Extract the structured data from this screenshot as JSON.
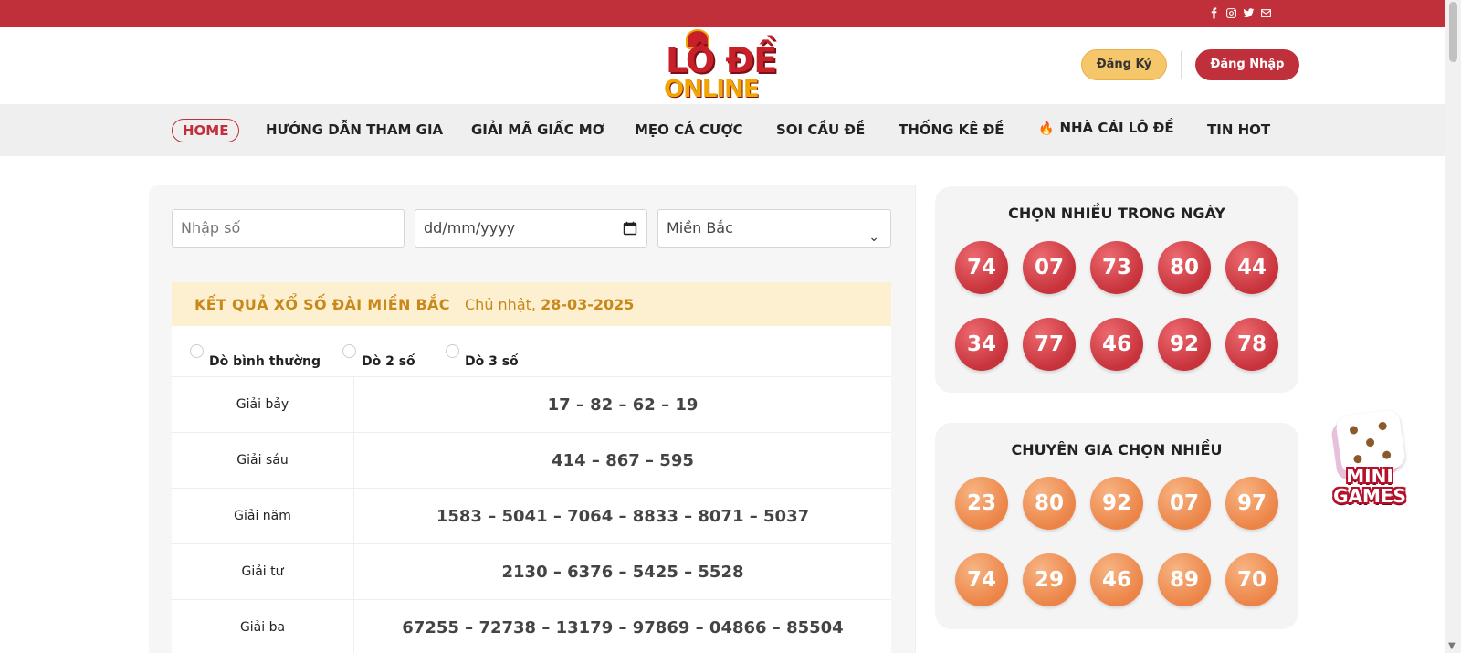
{
  "topbar": {
    "social_icons": [
      "facebook-icon",
      "instagram-icon",
      "twitter-icon",
      "mail-icon"
    ],
    "bg_color": "#c0303a"
  },
  "header": {
    "logo_line1": "LÔ ĐỀ",
    "logo_line2": "ONLINE",
    "register_label": "Đăng Ký",
    "login_label": "Đăng Nhập"
  },
  "nav": {
    "items": [
      "HOME",
      "HƯỚNG DẪN THAM GIA",
      "GIẢI MÃ GIẤC MƠ",
      "MẸO CÁ CƯỢC",
      "SOI CẦU ĐỀ",
      "THỐNG KÊ ĐỀ",
      "NHÀ CÁI LÔ ĐỀ",
      "TIN HOT"
    ],
    "active": "HOME"
  },
  "search": {
    "number_placeholder": "Nhập số",
    "date_placeholder": "dd/mm/yyyy",
    "region_selected": "Miền Bắc"
  },
  "result": {
    "title": "KẾT QUẢ XỔ SỐ ĐÀI MIỀN BẮC",
    "day_prefix": "Chủ nhật,",
    "date": "28-03-2025",
    "radio_options": [
      "Dò bình thường",
      "Dò 2 số",
      "Dò 3 số"
    ],
    "rows": [
      {
        "name": "Giải bảy",
        "numbers": "17 – 82 – 62 – 19"
      },
      {
        "name": "Giải sáu",
        "numbers": "414 – 867 – 595"
      },
      {
        "name": "Giải năm",
        "numbers": "1583 – 5041 – 7064 – 8833 – 8071 – 5037"
      },
      {
        "name": "Giải tư",
        "numbers": "2130 – 6376 – 5425 – 5528"
      },
      {
        "name": "Giải ba",
        "numbers": "67255 – 72738 – 13179 – 97869 – 04866 – 85504"
      }
    ]
  },
  "sidebar": {
    "popular": {
      "title": "CHỌN NHIỀU TRONG NGÀY",
      "balls": [
        "74",
        "07",
        "73",
        "80",
        "44",
        "34",
        "77",
        "46",
        "92",
        "78"
      ],
      "color": "#c7323b"
    },
    "experts": {
      "title": "CHUYÊN GIA CHỌN NHIỀU",
      "balls": [
        "23",
        "80",
        "92",
        "07",
        "97",
        "74",
        "29",
        "46",
        "89",
        "70"
      ],
      "color": "#ec8447"
    }
  },
  "minigames": {
    "line1": "MINI",
    "line2": "GAMES"
  }
}
